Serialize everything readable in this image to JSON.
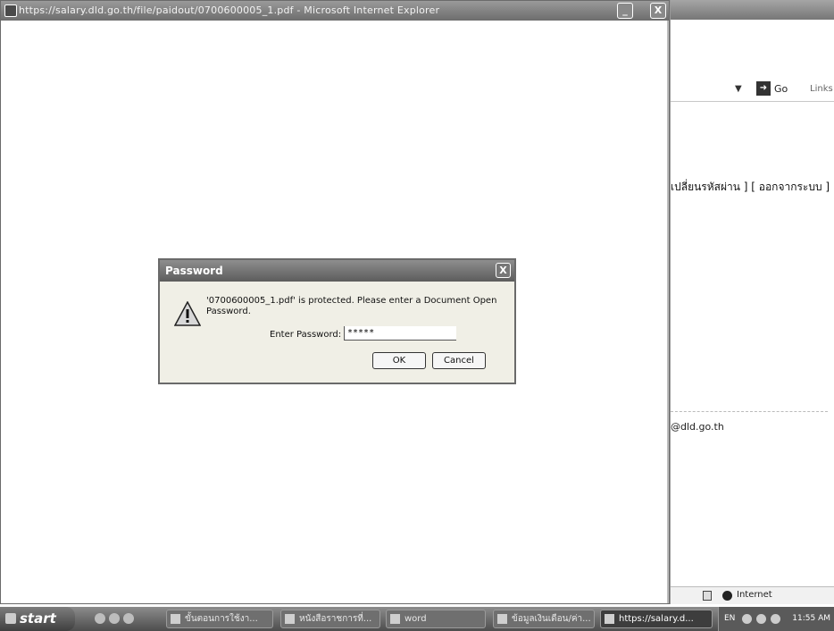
{
  "front_window": {
    "title": "https://salary.dld.go.th/file/paidout/0700600005_1.pdf - Microsoft Internet Explorer",
    "minimize_label": "_",
    "close_label": "X"
  },
  "back_window": {
    "go_label": "Go",
    "links_label": "Links",
    "thai_links": "เปลี่ยนรหัสผ่าน ] [ ออกจากระบบ ]",
    "email": "@dld.go.th",
    "zone_label": "Internet"
  },
  "dialog": {
    "title": "Password",
    "close_label": "X",
    "message": "'0700600005_1.pdf' is protected. Please enter a Document Open Password.",
    "password_label": "Enter Password:",
    "password_value": "*****",
    "ok_label": "OK",
    "cancel_label": "Cancel"
  },
  "taskbar": {
    "start_label": "start",
    "items": [
      {
        "label": "ขั้นตอนการใช้งา..."
      },
      {
        "label": "หนังสือราชการที่..."
      },
      {
        "label": "word"
      },
      {
        "label": "ข้อมูลเงินเดือน/ค่า..."
      },
      {
        "label": "https://salary.d..."
      }
    ],
    "language": "EN",
    "clock": "11:55 AM"
  }
}
